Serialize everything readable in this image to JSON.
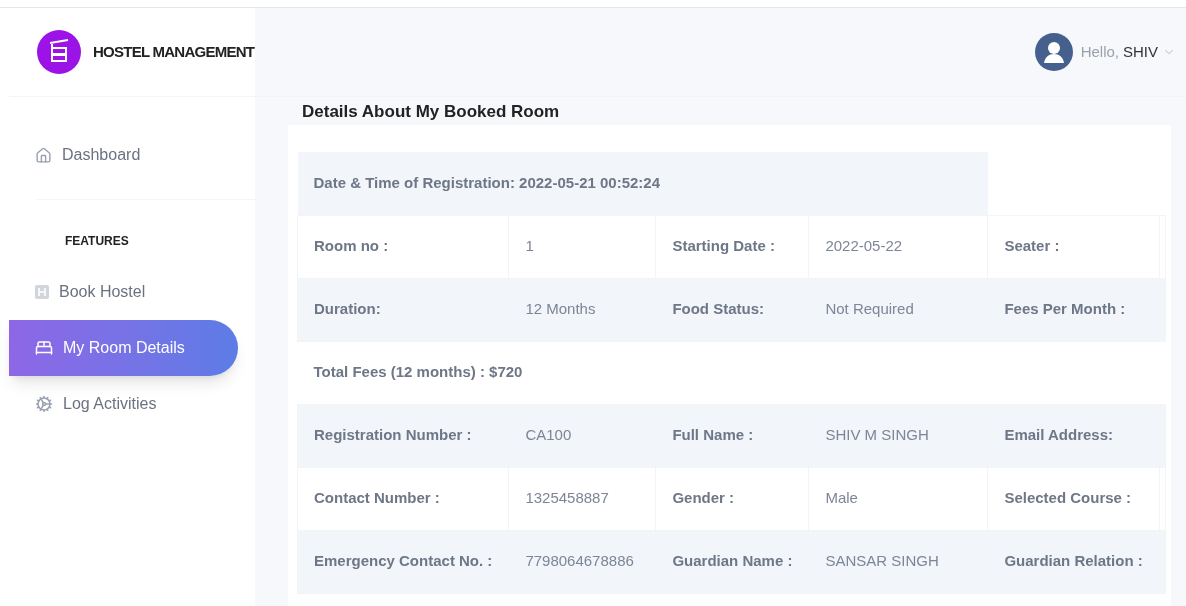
{
  "brand": {
    "name": "HOSTEL MANAGEMENT"
  },
  "header": {
    "greeting": "Hello,",
    "user": "SHIV"
  },
  "sidebar": {
    "items": [
      {
        "kind": "link",
        "label": "Dashboard",
        "selected": false
      },
      {
        "kind": "heading",
        "label": "FEATURES"
      },
      {
        "kind": "link",
        "label": "Book Hostel",
        "selected": false
      },
      {
        "kind": "link",
        "label": "My Room Details",
        "selected": true
      },
      {
        "kind": "link",
        "label": "Log Activities",
        "selected": false
      }
    ]
  },
  "page_title": "Details About My Booked Room",
  "table": {
    "rows": [
      {
        "kind": "caption",
        "text": "Date & Time of Registration: 2022-05-21 00:52:24"
      },
      {
        "kind": "pairs",
        "cells": [
          "Room no :",
          "1",
          "Starting Date :",
          "2022-05-22",
          "Seater :"
        ]
      },
      {
        "kind": "pairs",
        "cells": [
          "Duration:",
          "12 Months",
          "Food Status:",
          "Not Required",
          "Fees Per Month :"
        ]
      },
      {
        "kind": "total",
        "text": "Total Fees (12 months) : $720"
      },
      {
        "kind": "pairs",
        "cells": [
          "Registration Number :",
          "CA100",
          "Full Name :",
          "SHIV M SINGH",
          "Email Address:"
        ]
      },
      {
        "kind": "pairs",
        "cells": [
          "Contact Number :",
          "1325458887",
          "Gender :",
          "Male",
          "Selected Course :"
        ]
      },
      {
        "kind": "pairs",
        "cells": [
          "Emergency Contact No. :",
          "7798064678886",
          "Guardian Name :",
          "SANSAR SINGH",
          "Guardian Relation :"
        ]
      }
    ]
  }
}
